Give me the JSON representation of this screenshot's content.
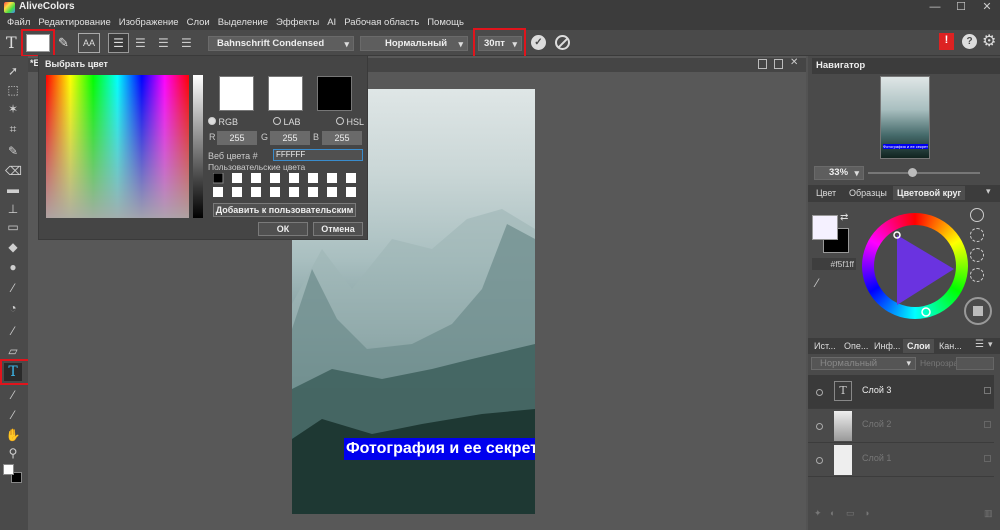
{
  "app": {
    "title": "AliveColors"
  },
  "window": {
    "minimize": "—",
    "maximize": "☐",
    "close": "✕"
  },
  "menu": [
    "Файл",
    "Редактирование",
    "Изображение",
    "Слои",
    "Выделение",
    "Эффекты",
    "AI",
    "Рабочая область",
    "Помощь"
  ],
  "options": {
    "tool_glyph": "T",
    "font_family": "Bahnschrift Condensed",
    "font_style": "Нормальный",
    "font_size": "30пт",
    "color_swatch": "#ffffff"
  },
  "document": {
    "tab_label": "*Б"
  },
  "canvas_text": "Фотография и ее секреты",
  "dialog": {
    "title": "Выбрать цвет",
    "swatches": [
      "#ffffff",
      "#ffffff",
      "#000000"
    ],
    "modes": [
      "RGB",
      "LAB",
      "HSL"
    ],
    "r_label": "R",
    "g_label": "G",
    "b_label": "B",
    "r": "255",
    "g": "255",
    "b": "255",
    "web_label": "Веб цвета #",
    "web_value": "FFFFFF",
    "custom_label": "Пользовательские цвета",
    "add_button": "Добавить к пользовательским",
    "ok": "ОК",
    "cancel": "Отмена"
  },
  "navigator": {
    "title": "Навигатор",
    "zoom": "33%",
    "thumb_text": "Фотография и ее секреты"
  },
  "color_panel": {
    "tabs": [
      "Цвет",
      "Образцы",
      "Цветовой круг"
    ],
    "hex": "#f5f1ff",
    "fg": "#f5f1ff",
    "bg": "#000000"
  },
  "layers_panel": {
    "tabs": [
      "Ист...",
      "Опе...",
      "Инф...",
      "Слои",
      "Кан..."
    ],
    "blend_mode": "Нормальный",
    "opacity_label": "Непрозрачность",
    "layers": [
      {
        "name": "Слой 3",
        "glyph": "T"
      },
      {
        "name": "Слой 2",
        "glyph": ""
      },
      {
        "name": "Слой 1",
        "glyph": ""
      }
    ]
  }
}
